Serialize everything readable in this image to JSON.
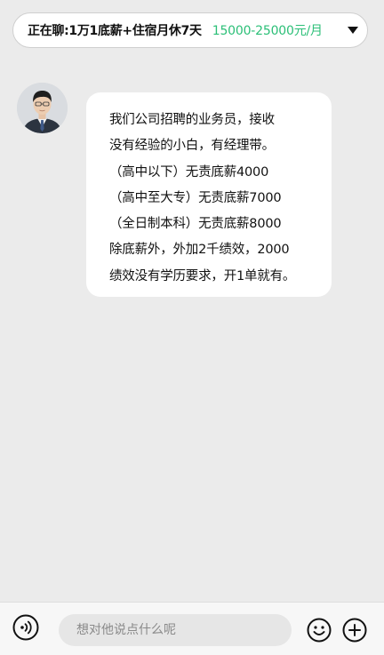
{
  "header": {
    "chatting_label": "正在聊:",
    "job_title": "1万1底薪+住宿月休7天",
    "salary": "15000-25000元/月",
    "salary_color": "#2bbf77",
    "dropdown_icon": "chevron-down-icon"
  },
  "conversation": {
    "avatar_icon": "recruiter-avatar",
    "message": {
      "lines": [
        "我们公司招聘的业务员，接收",
        "没有经验的小白，有经理带。",
        "（高中以下）无责底薪4000",
        "（高中至大专）无责底薪7000",
        "（全日制本科）无责底薪8000",
        "除底薪外，外加2千绩效，2000",
        "绩效没有学历要求，开1单就有。"
      ]
    }
  },
  "input_bar": {
    "voice_icon": "voice-icon",
    "placeholder": "想对他说点什么呢",
    "value": "",
    "emoji_icon": "emoji-icon",
    "plus_icon": "plus-icon"
  }
}
